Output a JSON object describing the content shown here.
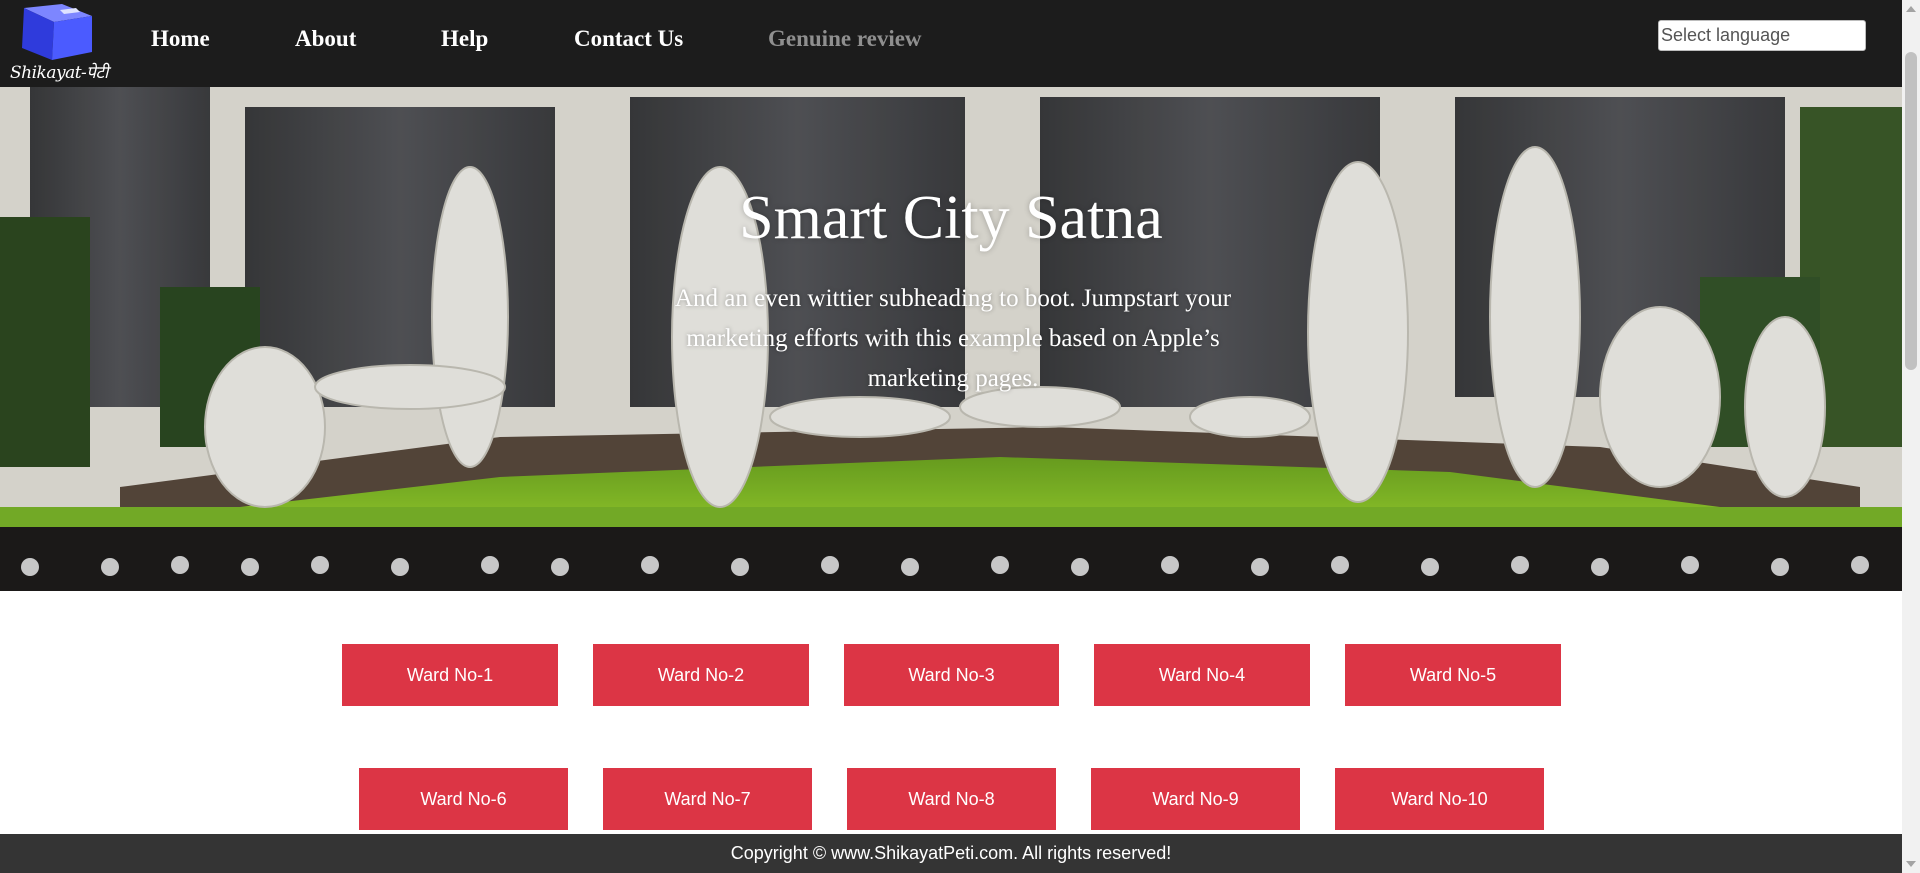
{
  "brand": {
    "logo_text": "Shikayat-पेटी"
  },
  "nav": {
    "home": "Home",
    "about": "About",
    "help": "Help",
    "contact": "Contact Us",
    "review": "Genuine review"
  },
  "language": {
    "placeholder": "Select language"
  },
  "hero": {
    "title": "Smart City Satna",
    "subtitle": "And an even wittier subheading to boot. Jumpstart your marketing efforts with this example based on Apple’s marketing pages."
  },
  "wards": [
    "Ward No-1",
    "Ward No-2",
    "Ward No-3",
    "Ward No-4",
    "Ward No-5",
    "Ward No-6",
    "Ward No-7",
    "Ward No-8",
    "Ward No-9",
    "Ward No-10"
  ],
  "footer": {
    "copyright": "Copyright © www.ShikayatPeti.com. All rights reserved!"
  },
  "colors": {
    "accent": "#dc3545",
    "navbar": "#1c1c1c",
    "footer": "#343434"
  }
}
